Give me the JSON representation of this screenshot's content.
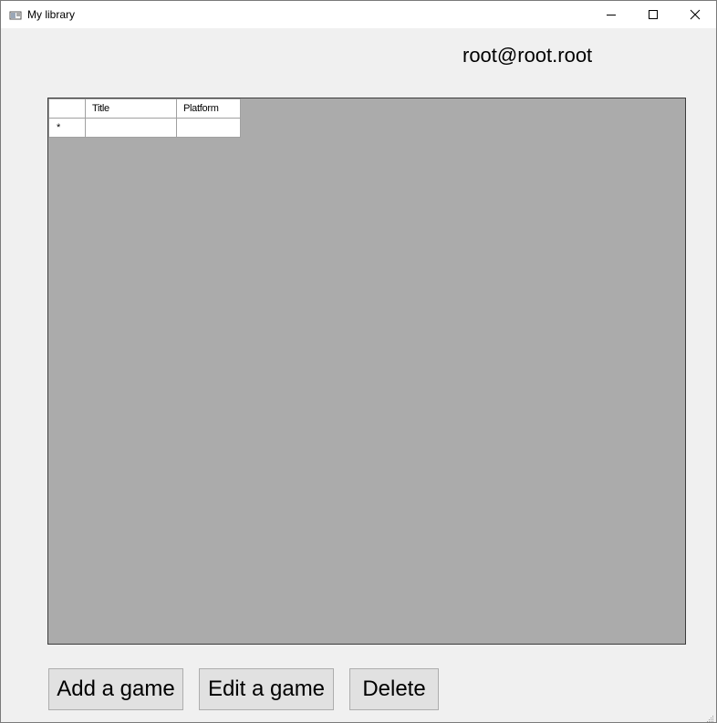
{
  "window": {
    "title": "My library",
    "controls": {
      "minimize": "minimize-icon",
      "maximize": "maximize-icon",
      "close": "close-icon"
    }
  },
  "user": {
    "email": "root@root.root"
  },
  "games_table": {
    "columns": [
      "Title",
      "Platform"
    ],
    "new_row_marker": "*",
    "rows": []
  },
  "actions": {
    "add_label": "Add a game",
    "edit_label": "Edit a game",
    "delete_label": "Delete"
  },
  "colors": {
    "form_background": "#f0f0f0",
    "grid_background": "#ababab",
    "button_face": "#e1e1e1"
  }
}
